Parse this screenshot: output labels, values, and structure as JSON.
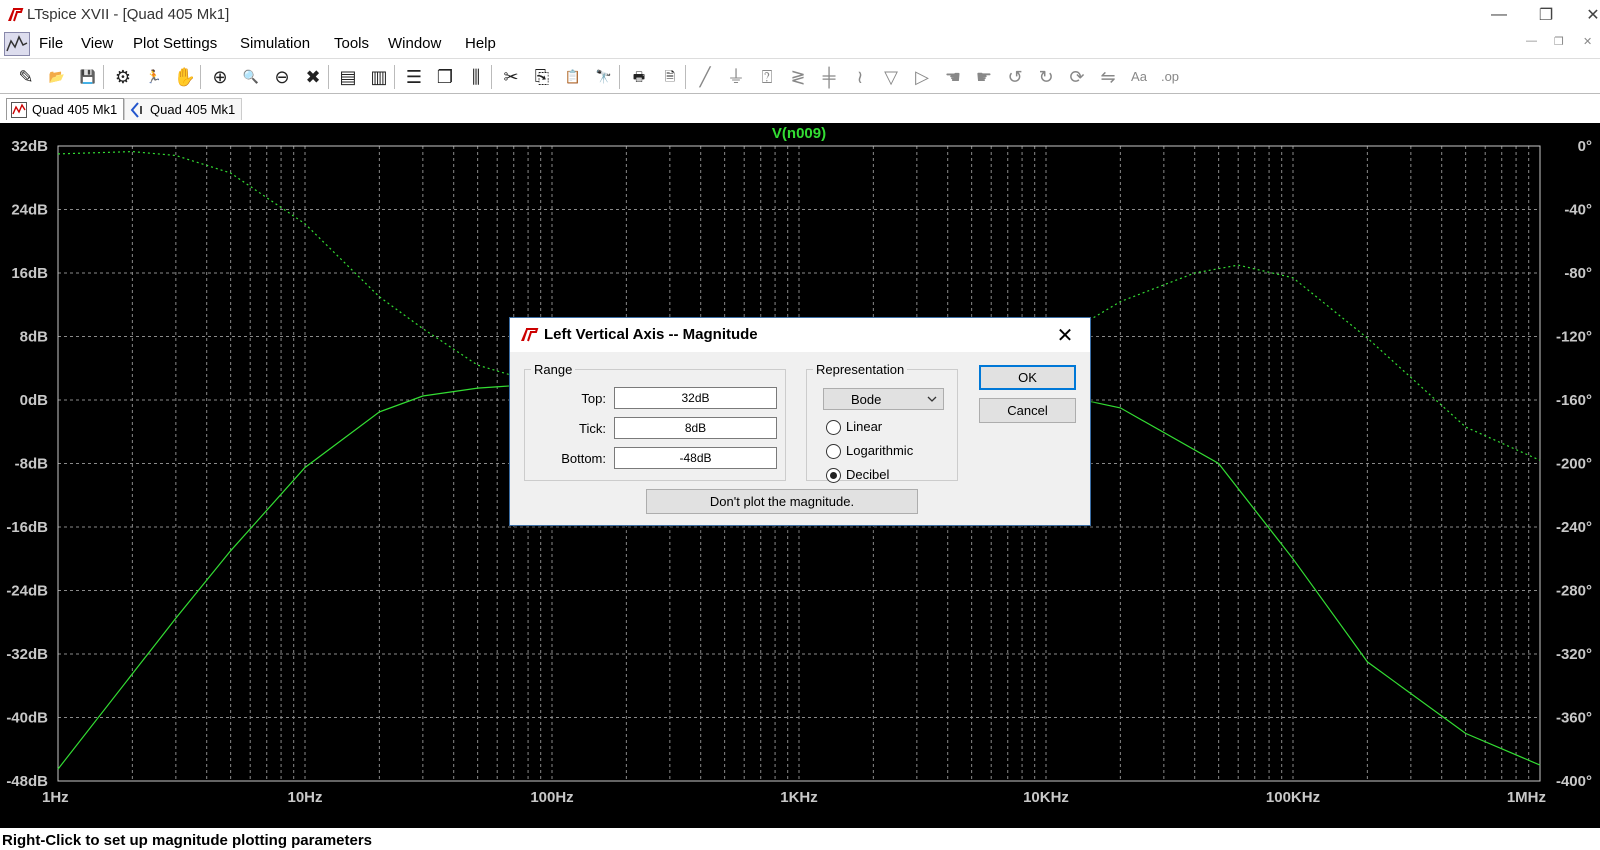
{
  "window": {
    "title": "LTspice XVII - [Quad 405 Mk1]",
    "controls": [
      "minimize",
      "restore",
      "close"
    ]
  },
  "menu": {
    "items": [
      "File",
      "View",
      "Plot Settings",
      "Simulation",
      "Tools",
      "Window",
      "Help"
    ]
  },
  "toolbar": {
    "icons": [
      "new-schematic-icon",
      "open-icon",
      "save-icon",
      "control-panel-icon",
      "run-icon",
      "halt-icon",
      "zoom-area-icon",
      "zoom-in-icon",
      "zoom-out-icon",
      "zoom-cancel-icon",
      "autorange-icon",
      "plot-settings-icon",
      "tile-horizontal-icon",
      "cascade-icon",
      "tile-vertical-icon",
      "cut-icon",
      "copy-icon",
      "paste-icon",
      "find-icon",
      "print-icon",
      "print-preview-icon",
      "wire-icon",
      "ground-icon",
      "label-net-icon",
      "resistor-icon",
      "capacitor-icon",
      "inductor-icon",
      "diode-icon",
      "component-icon",
      "move-icon",
      "drag-icon",
      "undo-icon",
      "redo-icon",
      "rotate-icon",
      "mirror-icon",
      "text-icon",
      "spice-directive-icon"
    ]
  },
  "tabs": [
    {
      "label": "Quad 405 Mk1",
      "icon": "waveform-icon",
      "active": true
    },
    {
      "label": "Quad 405 Mk1",
      "icon": "schematic-icon",
      "active": false
    }
  ],
  "plot": {
    "trace_name": "V(n009)",
    "trace_color": "#33dd33",
    "left_ticks": [
      "32dB",
      "24dB",
      "16dB",
      "8dB",
      "0dB",
      "-8dB",
      "-16dB",
      "-24dB",
      "-32dB",
      "-40dB",
      "-48dB"
    ],
    "right_ticks": [
      "0°",
      "-40°",
      "-80°",
      "-120°",
      "-160°",
      "-200°",
      "-240°",
      "-280°",
      "-320°",
      "-360°",
      "-400°"
    ],
    "x_ticks": [
      "1Hz",
      "10Hz",
      "100Hz",
      "1KHz",
      "10KHz",
      "100KHz",
      "1MHz"
    ]
  },
  "chart_data": {
    "type": "line",
    "title": "V(n009)",
    "xscale": "log",
    "xlim": [
      1,
      1000000
    ],
    "ylim_left": [
      -48,
      32
    ],
    "ylim_right": [
      -400,
      0
    ],
    "grid": true,
    "series": [
      {
        "name": "magnitude",
        "style": "solid",
        "axis": "left",
        "x": [
          1,
          2,
          3,
          5,
          10,
          20,
          30,
          50,
          70,
          100,
          200,
          500,
          1000,
          2000,
          5000,
          10000,
          20000,
          50000,
          100000,
          200000,
          500000,
          1000000
        ],
        "y": [
          -46.5,
          -34.5,
          -27.5,
          -19.0,
          -8.5,
          -1.5,
          0.5,
          1.5,
          1.8,
          1.9,
          2.0,
          2.0,
          2.0,
          2.0,
          2.0,
          1.0,
          -1.0,
          -8.0,
          -20.0,
          -33.0,
          -42.0,
          -46.0
        ]
      },
      {
        "name": "phase",
        "style": "dashed",
        "axis": "right",
        "x": [
          1,
          2,
          3,
          5,
          10,
          20,
          30,
          50,
          100,
          300,
          1000,
          3000,
          5000,
          10000,
          20000,
          40000,
          60000,
          100000,
          200000,
          500000,
          1000000
        ],
        "y": [
          -5.0,
          -3.5,
          -6.0,
          -17.0,
          -49.0,
          -95.0,
          -115.0,
          -138.0,
          -152.0,
          -157.0,
          -158.0,
          -154.0,
          -146.0,
          -126.0,
          -98.0,
          -80.0,
          -75.0,
          -83.0,
          -121.0,
          -177.0,
          -198.0
        ]
      }
    ]
  },
  "status": {
    "text": "Right-Click to set up magnitude plotting parameters"
  },
  "dialog": {
    "title": "Left Vertical Axis -- Magnitude",
    "range_legend": "Range",
    "top_label": "Top:",
    "top_value": "32dB",
    "tick_label": "Tick:",
    "tick_value": "8dB",
    "bottom_label": "Bottom:",
    "bottom_value": "-48dB",
    "representation_legend": "Representation",
    "representation_value": "Bode",
    "radio_linear": "Linear",
    "radio_logarithmic": "Logarithmic",
    "radio_decibel": "Decibel",
    "selected_representation": "Decibel",
    "ok_label": "OK",
    "cancel_label": "Cancel",
    "dont_plot_label": "Don't plot the magnitude."
  }
}
